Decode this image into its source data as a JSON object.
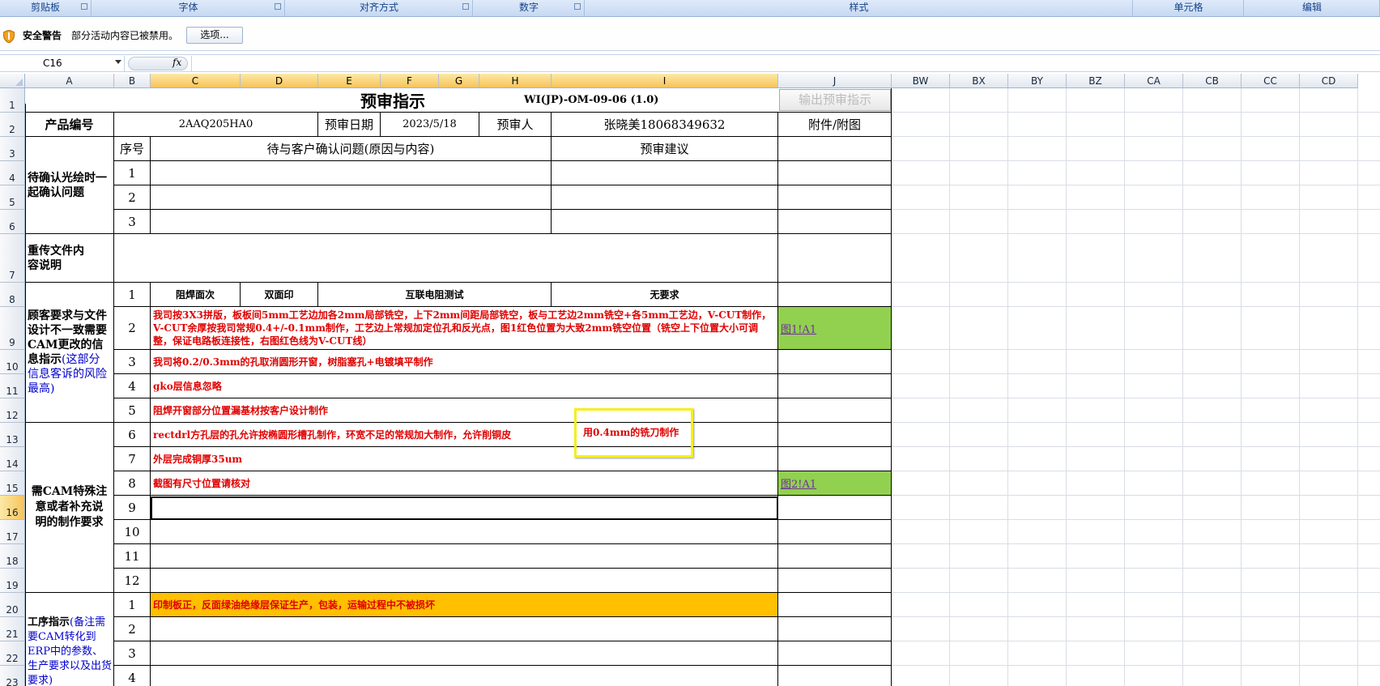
{
  "ribbon": {
    "groups": [
      "剪贴板",
      "字体",
      "对齐方式",
      "数字",
      "样式",
      "单元格",
      "编辑"
    ]
  },
  "security": {
    "title": "安全警告",
    "message": "部分活动内容已被禁用。",
    "options_button": "选项..."
  },
  "formula_bar": {
    "name_box": "C16",
    "fx": "fx",
    "value": ""
  },
  "columns": [
    "A",
    "B",
    "C",
    "D",
    "E",
    "F",
    "G",
    "H",
    "I",
    "J",
    "BW",
    "BX",
    "BY",
    "BZ",
    "CA",
    "CB",
    "CC",
    "CD"
  ],
  "rows": [
    "1",
    "2",
    "3",
    "4",
    "5",
    "6",
    "7",
    "8",
    "9",
    "10",
    "11",
    "12",
    "13",
    "14",
    "15",
    "16",
    "17",
    "18",
    "19",
    "20",
    "21",
    "22",
    "23"
  ],
  "header_button": "输出预审指示",
  "sheet": {
    "title": "预审指示",
    "doc_code": "WI(JP)-OM-09-06 (1.0)",
    "product_no_label": "产品编号",
    "product_no": "2AAQ205HA0",
    "review_date_label": "预审日期",
    "review_date": "2023/5/18",
    "reviewer_label": "预审人",
    "reviewer": "张晓美18068349632",
    "attachment_label": "附件/附图",
    "seq_label": "序号",
    "issues_label": "待与客户确认问题(原因与内容)",
    "suggest_label": "预审建议",
    "confirm_section": "待确认光绘时一起确认问题",
    "seq": [
      "1",
      "2",
      "3",
      "4",
      "5",
      "6",
      "7",
      "8",
      "9",
      "10",
      "11",
      "12"
    ],
    "reupload_label": "重传文件内容说明",
    "customer_section_a": "顾客要求与文件设计不一致需要CAM更改的信息指示",
    "customer_section_b": "(这部分信息客诉的风险最高)",
    "solder_face": "阻焊面次",
    "silk": "双面印",
    "etest": "互联电阻测试",
    "norequest": "无要求",
    "item2": "我司按3X3拼版，板板间5mm工艺边加各2mm局部铣空，上下2mm间距局部铣空，板与工艺边2mm铣空+各5mm工艺边，V-CUT制作，V-CUT余厚按我司常规0.4+/-0.1mm制作，工艺边上常规加定位孔和反光点，图1红色位置为大致2mm铣空位置（铣空上下位置大小可调整，保证电路板连接性，右图红色线为V-CUT线）",
    "link1": "图1!A1",
    "item3": "我司将0.2/0.3mm的孔取消圆形开窗，树脂塞孔+电镀填平制作",
    "item4": "gko层信息忽略",
    "item5": "阻焊开窗部分位置漏基材按客户设计制作",
    "cam_section": "需CAM特殊注意或者补充说明的制作要求",
    "item6": "rectdrl方孔层的孔允许按椭圆形槽孔制作，环宽不足的常规加大制作，允许削铜皮",
    "item6_note": "用0.4mm的铣刀制作",
    "item7": "外层完成铜厚35um",
    "item8": "截图有尺寸位置请核对",
    "link2": "图2!A1",
    "process_section_a": "工序指示",
    "process_section_b": "(备注需要CAM转化到ERP中的参数、生产要求以及出货要求)",
    "proc1": "印制板正，反面绿油绝缘层保证生产，包装，运输过程中不被损坏",
    "proc_seq": [
      "1",
      "2",
      "3",
      "4"
    ]
  },
  "colors": {
    "green": "#92d050",
    "orange": "#ffc000",
    "red": "#e00000",
    "callout": "#f4f01c"
  }
}
